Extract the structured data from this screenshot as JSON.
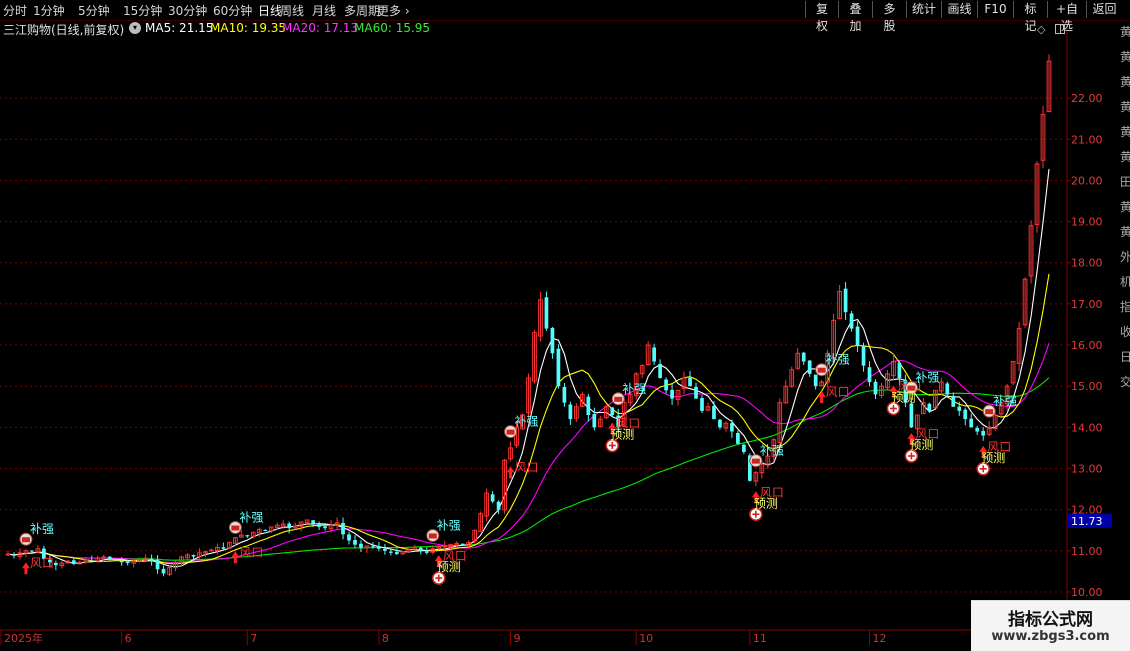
{
  "toolbar": {
    "periods": [
      "分时",
      "1分钟",
      "5分钟",
      "15分钟",
      "30分钟",
      "60分钟",
      "日线",
      "周线",
      "月线",
      "多周期",
      "更多"
    ],
    "active_period": "日线",
    "buttons": [
      "复权",
      "叠加",
      "多股",
      "统计",
      "画线",
      "F10",
      "标记",
      "+自选",
      "返回"
    ]
  },
  "info": {
    "title": "三江购物(日线,前复权)",
    "ma5": "MA5: 21.15",
    "ma10": "MA10: 19.35",
    "ma20": "MA20: 17.13",
    "ma60": "MA60: 15.95"
  },
  "colors": {
    "up": "#ff3232",
    "down": "#54fcfc",
    "ma5": "#ffffff",
    "ma10": "#ffff00",
    "ma20": "#ff00ff",
    "ma60": "#00e600",
    "grid": "#7a0000",
    "axis": "#8a0000",
    "price_tag": "#0000a8",
    "signal_text": "#ffff66",
    "wind_text": "#ff3333",
    "bu_text": "#66ffff"
  },
  "watermark": {
    "line1": "指标公式网",
    "line2": "www.zbgs3.com"
  },
  "side_strip_chars": [
    "黄",
    "黄",
    "黄",
    "黄",
    "黄",
    "黄",
    "田",
    "黄",
    "黄",
    "外",
    "机",
    "指",
    "收",
    "日",
    "交"
  ],
  "chart_data": {
    "type": "candlestick",
    "ylim": [
      9.95,
      23.0
    ],
    "y_ticks": [
      "10.00",
      "11.00",
      "12.00",
      "13.00",
      "14.00",
      "15.00",
      "16.00",
      "17.00",
      "18.00",
      "19.00",
      "20.00",
      "21.00",
      "22.00"
    ],
    "last_price_tag": "11.73",
    "x_labels": [
      {
        "text": "2025年",
        "index": 0
      },
      {
        "text": "6",
        "index": 19
      },
      {
        "text": "7",
        "index": 40
      },
      {
        "text": "8",
        "index": 62
      },
      {
        "text": "9",
        "index": 84
      },
      {
        "text": "10",
        "index": 105
      },
      {
        "text": "11",
        "index": 124
      },
      {
        "text": "12",
        "index": 144
      }
    ],
    "closes": [
      10.92,
      10.88,
      10.95,
      11.0,
      10.98,
      11.05,
      10.8,
      10.72,
      10.65,
      10.7,
      10.75,
      10.68,
      10.72,
      10.78,
      10.74,
      10.82,
      10.85,
      10.8,
      10.76,
      10.72,
      10.7,
      10.75,
      10.78,
      10.82,
      10.75,
      10.55,
      10.45,
      10.6,
      10.72,
      10.85,
      10.9,
      10.86,
      10.95,
      10.98,
      11.02,
      11.08,
      11.05,
      11.2,
      11.32,
      11.38,
      11.35,
      11.45,
      11.52,
      11.48,
      11.58,
      11.62,
      11.65,
      11.55,
      11.6,
      11.7,
      11.75,
      11.66,
      11.58,
      11.55,
      11.62,
      11.68,
      11.4,
      11.25,
      11.15,
      11.08,
      11.12,
      11.1,
      11.05,
      11.0,
      10.95,
      10.92,
      10.98,
      11.02,
      11.08,
      11.0,
      10.95,
      11.05,
      11.1,
      11.12,
      11.15,
      11.18,
      11.12,
      11.2,
      11.5,
      11.9,
      12.4,
      12.2,
      12.0,
      13.2,
      13.5,
      14.0,
      14.3,
      15.2,
      16.3,
      17.1,
      16.4,
      15.8,
      15.0,
      14.6,
      14.2,
      14.5,
      14.8,
      14.3,
      14.0,
      14.2,
      14.5,
      14.3,
      14.0,
      14.6,
      14.8,
      15.3,
      15.5,
      16.0,
      15.6,
      15.2,
      14.9,
      14.7,
      14.9,
      15.2,
      15.0,
      14.7,
      14.4,
      14.5,
      14.2,
      14.0,
      14.1,
      13.9,
      13.6,
      13.4,
      12.7,
      12.9,
      13.1,
      13.3,
      13.7,
      14.6,
      15.0,
      15.4,
      15.8,
      15.6,
      15.3,
      15.0,
      15.1,
      15.8,
      16.6,
      17.3,
      16.8,
      16.4,
      16.0,
      15.5,
      15.1,
      14.8,
      15.0,
      15.3,
      15.6,
      15.2,
      14.6,
      14.0,
      14.3,
      14.6,
      14.4,
      14.9,
      15.1,
      14.8,
      14.5,
      14.4,
      14.2,
      14.0,
      13.9,
      13.8,
      14.0,
      14.3,
      14.6,
      15.0,
      15.6,
      16.4,
      17.6,
      18.9,
      20.4,
      21.6,
      22.9
    ],
    "ma_values": {
      "MA5": 21.15,
      "MA10": 19.35,
      "MA20": 17.13,
      "MA60": 15.95
    },
    "signals": [
      {
        "index": 3,
        "type": "补强"
      },
      {
        "index": 3,
        "type": "风口"
      },
      {
        "index": 38,
        "type": "补强"
      },
      {
        "index": 38,
        "type": "风口"
      },
      {
        "index": 71,
        "type": "补强"
      },
      {
        "index": 72,
        "type": "风口"
      },
      {
        "index": 72,
        "type": "预测"
      },
      {
        "index": 84,
        "type": "补强"
      },
      {
        "index": 84,
        "type": "风口"
      },
      {
        "index": 102,
        "type": "补强"
      },
      {
        "index": 101,
        "type": "风口"
      },
      {
        "index": 101,
        "type": "预测"
      },
      {
        "index": 125,
        "type": "补强"
      },
      {
        "index": 125,
        "type": "风口"
      },
      {
        "index": 125,
        "type": "预测"
      },
      {
        "index": 136,
        "type": "补强"
      },
      {
        "index": 136,
        "type": "风口"
      },
      {
        "index": 148,
        "type": "风口"
      },
      {
        "index": 151,
        "type": "补强"
      },
      {
        "index": 148,
        "type": "预测"
      },
      {
        "index": 151,
        "type": "风口"
      },
      {
        "index": 151,
        "type": "预测"
      },
      {
        "index": 164,
        "type": "补强"
      },
      {
        "index": 163,
        "type": "风口"
      },
      {
        "index": 163,
        "type": "预测"
      }
    ]
  }
}
